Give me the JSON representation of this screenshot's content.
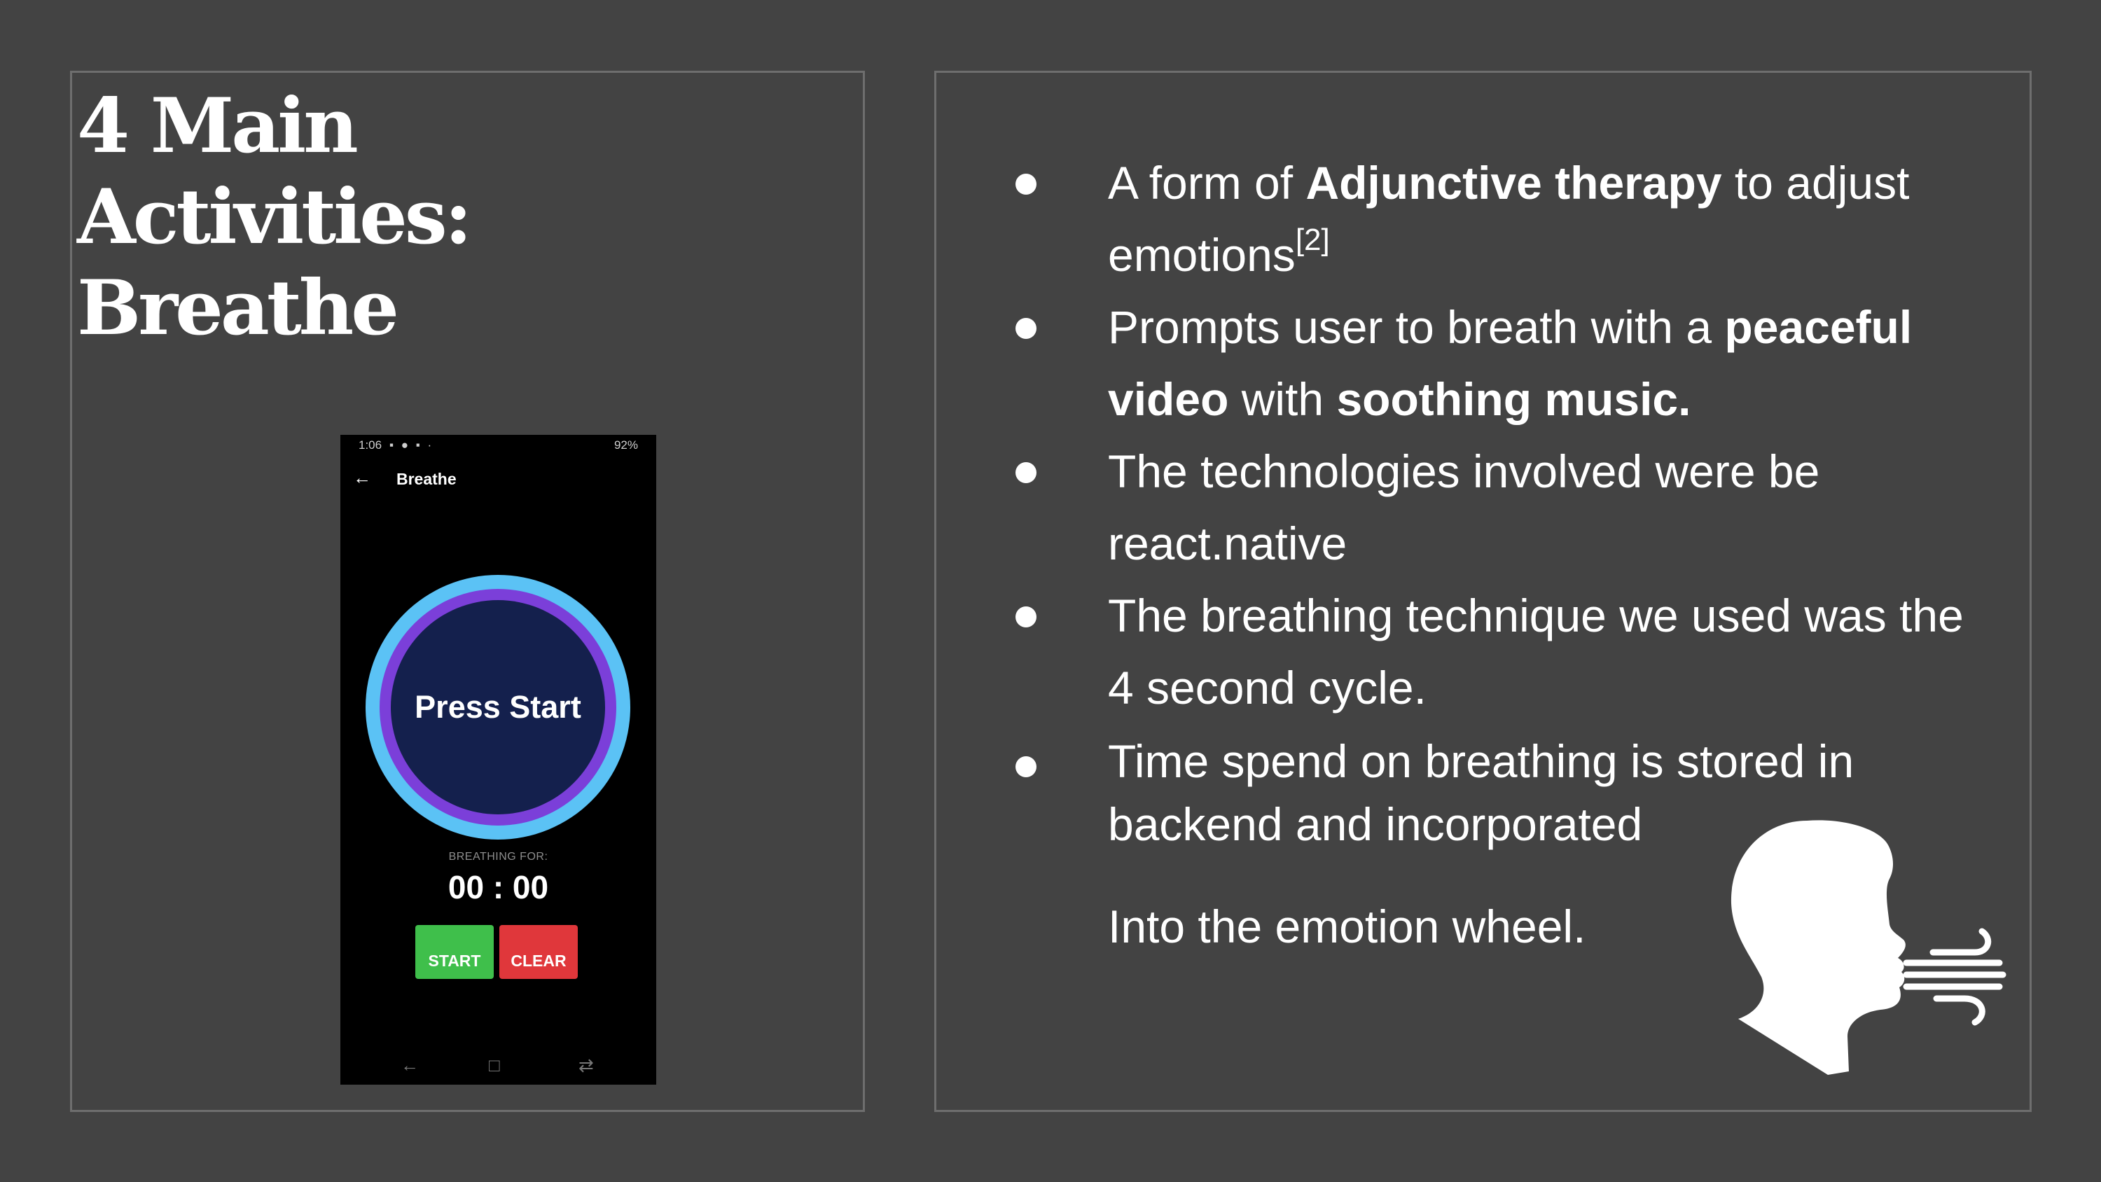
{
  "slide": {
    "title_lines": [
      "4 Main",
      "Activities:",
      "Breathe"
    ],
    "background": "#434343"
  },
  "phone": {
    "status_time": "1:06",
    "status_battery": "92%",
    "app_title": "Breathe",
    "circle_label": "Press Start",
    "breathing_label": "BREATHING FOR:",
    "timer": "00 : 00",
    "start_label": "START",
    "clear_label": "CLEAR",
    "colors": {
      "ring_outer": "#5bc2f5",
      "ring_mid": "#7b3fd9",
      "ring_inner": "#14204d",
      "start": "#3fbf4b",
      "clear": "#e0373b"
    }
  },
  "bullets": [
    {
      "pre": "A form of ",
      "bold": "Adjunctive therapy",
      "post": " to adjust emotions",
      "sup": "[2]"
    },
    {
      "pre": "Prompts user to breath with a ",
      "bold": "peaceful video",
      "mid": " with ",
      "bold2": "soothing music."
    },
    {
      "text": "The technologies involved were be react.native"
    },
    {
      "text": "The breathing technique we used was the 4 second cycle."
    },
    {
      "text": "Time spend on breathing is stored in backend and incorporated"
    }
  ],
  "continuation": "Into the emotion wheel.",
  "icons": {
    "phone_back": "arrow-left-icon",
    "person": "breathing-person-icon"
  }
}
